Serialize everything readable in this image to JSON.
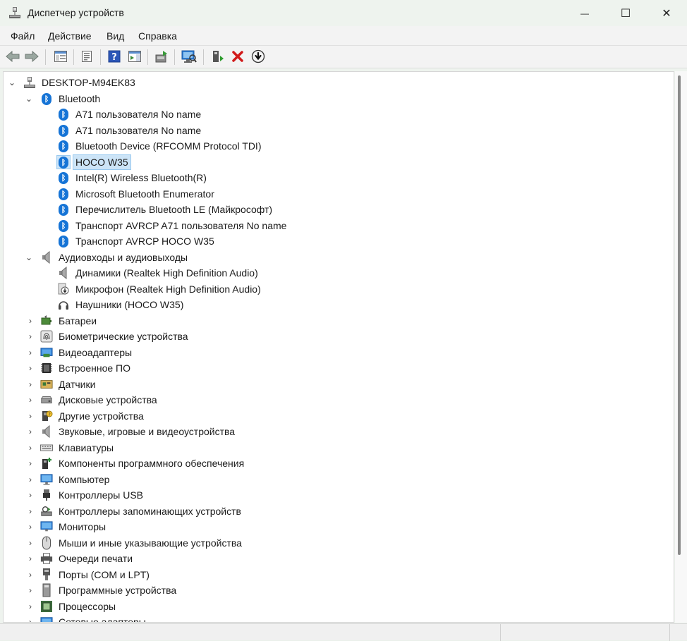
{
  "window": {
    "title": "Диспетчер устройств",
    "minimize_glyph": "—",
    "maximize_glyph": "☐",
    "close_glyph": "✕"
  },
  "menu": [
    "Файл",
    "Действие",
    "Вид",
    "Справка"
  ],
  "toolbar": {
    "buttons": [
      "back-icon",
      "forward-icon",
      "show-hide-tree-icon",
      "properties-icon",
      "help-icon",
      "action-pane-icon",
      "update-driver-icon",
      "scan-hardware-icon",
      "add-driver-icon",
      "uninstall-device-icon",
      "disable-device-icon"
    ]
  },
  "tree": {
    "root": "DESKTOP-M94EK83",
    "bluetooth": {
      "label": "Bluetooth",
      "items": [
        "A71 пользователя No name",
        "A71 пользователя No name",
        "Bluetooth Device (RFCOMM Protocol TDI)",
        "HOCO W35",
        "Intel(R) Wireless Bluetooth(R)",
        "Microsoft Bluetooth Enumerator",
        "Перечислитель Bluetooth LE (Майкрософт)",
        "Транспорт AVRCP A71 пользователя No name",
        "Транспорт AVRCP HOCO W35"
      ],
      "selected_index": 3
    },
    "audio": {
      "label": "Аудиовходы и аудиовыходы",
      "items": [
        "Динамики (Realtek High Definition Audio)",
        "Микрофон (Realtek High Definition Audio)",
        "Наушники (HOCO W35)"
      ]
    },
    "categories": [
      "Батареи",
      "Биометрические устройства",
      "Видеоадаптеры",
      "Встроенное ПО",
      "Датчики",
      "Дисковые устройства",
      "Другие устройства",
      "Звуковые, игровые и видеоустройства",
      "Клавиатуры",
      "Компоненты программного обеспечения",
      "Компьютер",
      "Контроллеры USB",
      "Контроллеры запоминающих устройств",
      "Мониторы",
      "Мыши и иные указывающие устройства",
      "Очереди печати",
      "Порты (COM и LPT)",
      "Программные устройства",
      "Процессоры",
      "Сетевые адаптеры"
    ]
  },
  "glyphs": {
    "expanded": "⌄",
    "collapsed": "›",
    "bluetooth": "ᛒ"
  },
  "colors": {
    "accent": "#1674d6",
    "selection": "#cce4f7"
  }
}
